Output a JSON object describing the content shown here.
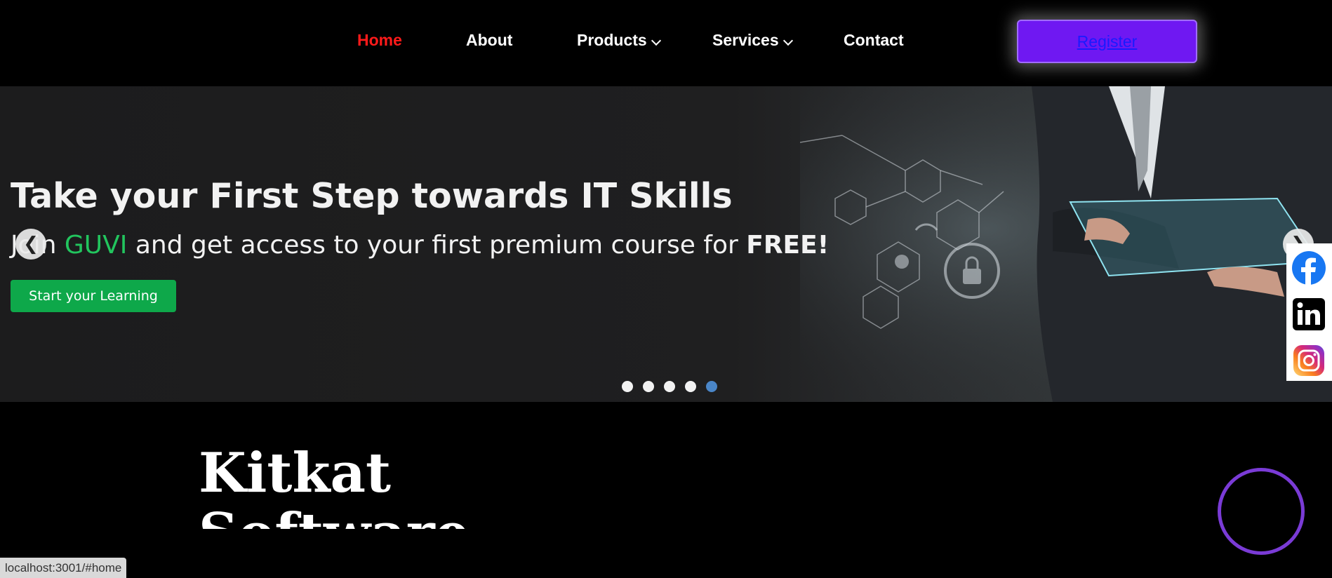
{
  "nav": {
    "items": [
      {
        "label": "Home",
        "active": true
      },
      {
        "label": "About"
      },
      {
        "label": "Products",
        "dropdown": true
      },
      {
        "label": "Services",
        "dropdown": true
      },
      {
        "label": "Contact"
      }
    ],
    "register_label": "Register"
  },
  "hero": {
    "title": "Take your First Step towards IT Skills",
    "subtitle_prefix": "Join ",
    "subtitle_brand": "GUVI",
    "subtitle_middle": " and get access to your first premium course for ",
    "subtitle_emphasis": "FREE!",
    "cta_label": "Start your Learning",
    "prev_arrow": "❮",
    "next_arrow": "❯",
    "slide_count": 5,
    "active_slide": 5,
    "brand_color": "#22c55e"
  },
  "social": [
    "facebook-icon",
    "linkedin-icon",
    "instagram-icon"
  ],
  "about": {
    "line1": "Kitkat",
    "line2": "Software"
  },
  "statusbar": {
    "url": "localhost:3001/#home"
  },
  "colors": {
    "nav_active": "#ff1a1a",
    "register_bg": "#6f18f2",
    "cta_bg": "#0ea84a",
    "dot_active": "#4a86c8",
    "ring": "#7a3bd6"
  }
}
